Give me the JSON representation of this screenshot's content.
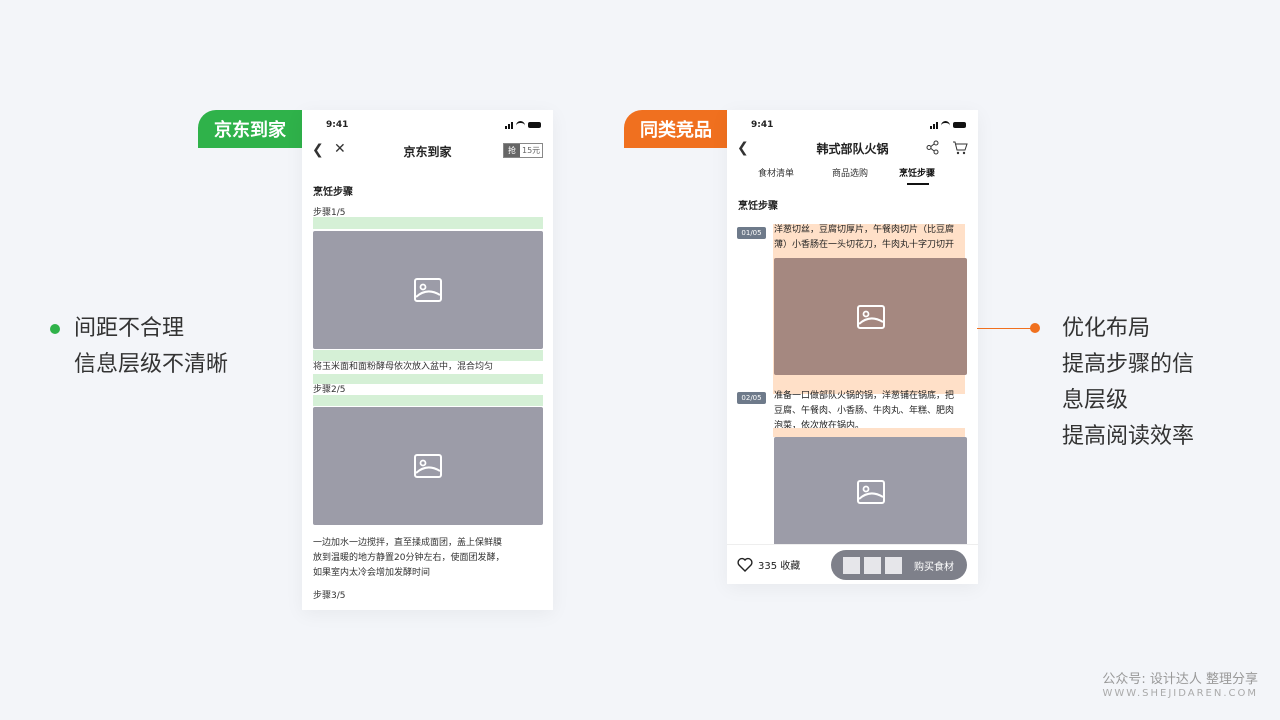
{
  "left_tag": "京东到家",
  "right_tag": "同类竞品",
  "colors": {
    "green": "#2fb24a",
    "orange": "#f0701f",
    "placeholder": "#9c9ca8"
  },
  "phone1": {
    "time": "9:41",
    "title": "京东到家",
    "grab_badge": "抢",
    "coupon_badge": "15元",
    "section_title": "烹饪步骤",
    "step1_label": "步骤1/5",
    "step1_text": "将玉米面和面粉酵母依次放入盆中，混合均匀",
    "step2_label": "步骤2/5",
    "step2_text_lines": [
      "一边加水一边搅拌，直至揉成面团，盖上保鲜膜",
      "放到温暖的地方静置20分钟左右，使面团发酵，",
      "如果室内太冷会增加发酵时间"
    ],
    "step3_label": "步骤3/5"
  },
  "phone2": {
    "time": "9:41",
    "title": "韩式部队火锅",
    "tabs": [
      "食材清单",
      "商品选购",
      "烹饪步骤"
    ],
    "active_tab": 2,
    "section_title": "烹饪步骤",
    "step1_badge": "01/05",
    "step1_text_lines": [
      "洋葱切丝，豆腐切厚片，午餐肉切片（比豆腐",
      "薄）小香肠在一头切花刀，牛肉丸十字刀切开"
    ],
    "step2_badge": "02/05",
    "step2_text_lines": [
      "准备一口做部队火锅的锅，洋葱铺在锅底，把",
      "豆腐、午餐肉、小香肠、牛肉丸、年糕、肥肉",
      "泡菜，依次放在锅内。"
    ],
    "favorites": "335 收藏",
    "buy_label": "购买食材"
  },
  "left_annotation": [
    "间距不合理",
    "信息层级不清晰"
  ],
  "right_annotation": [
    "优化布局",
    "提高步骤的信",
    "息层级",
    "提高阅读效率"
  ],
  "watermark": {
    "line1": "公众号: 设计达人 整理分享",
    "line2": "WWW.SHEJIDAREN.COM"
  }
}
